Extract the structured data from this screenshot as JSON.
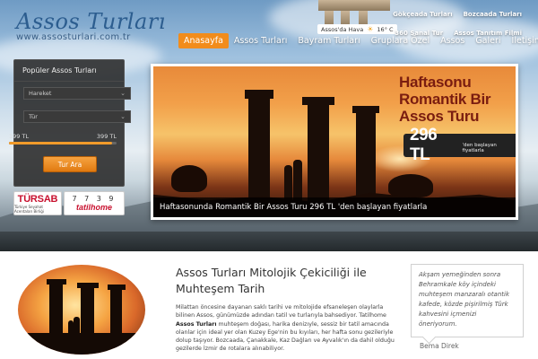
{
  "header": {
    "logo_title": "Assos Turları",
    "logo_url": "www.assosturlari.com.tr",
    "weather_label": "Assos'da Hava",
    "weather_temp": "16° C",
    "top_links_row1": [
      "Gökçeada Turları",
      "Bozcaada Turları"
    ],
    "top_links_row2": [
      "360 Sanal Tur",
      "Assos Tanıtım Filmi"
    ]
  },
  "nav": {
    "items": [
      "Anasayfa",
      "Assos Turları",
      "Bayram Turları",
      "Gruplara Özel",
      "Assos",
      "Galeri",
      "İletişim"
    ],
    "active_index": 0
  },
  "search": {
    "title": "Popüler Assos Turları",
    "departure_placeholder": "Hareket",
    "type_placeholder": "Tür",
    "price_min": "199 TL",
    "price_max": "399 TL",
    "range_fill_fraction": 0.96,
    "button_label": "Tur Ara"
  },
  "badges": {
    "tursab": "TÜRSAB",
    "tursab_sub": "Türkiye Seyahat Acentaları Birliği",
    "tatil_digits": "7 7 3 9",
    "tatil_name": "tatilhome"
  },
  "slider": {
    "headline_lines": [
      "Haftasonu",
      "Romantik Bir",
      "Assos Turu"
    ],
    "price": "296 TL",
    "price_suffix": "'den başlayan fiyatlarla",
    "caption": "Haftasonunda Romantik Bir Assos Turu 296 TL 'den başlayan fiyatlarla"
  },
  "article": {
    "title": "Assos Turları Mitolojik Çekiciliği ile Muhteşem Tarih",
    "body_1": "Milattan öncesine dayanan saklı tarihi ve mitolojide efsaneleşen olaylarla bilinen Assos, günümüzde adından tatil ve turlarıyla bahsediyor. Tatilhome ",
    "body_bold": "Assos Turları",
    "body_2": " muhteşem doğası, harika denizıyle, sessiz bir tatil amacında olanlar için ideal yer olan Kuzey Ege'nin bu kıyıları, her hafta sonu gezileriyle dolup taşıyor. Bozcaada, Çanakkale, Kaz Dağları ve Ayvalık'ın da dahil olduğu gezilerde İzmir de rotalara alınabiliyor."
  },
  "testimonial": {
    "text": "Akşam yemeğinden sonra Behramkale köy içindeki muhteşem manzaralı otantik kafede, közde pişirilmiş Türk kahvesini içmenizi öneriyorum.",
    "author": "Bema Direk"
  },
  "colors": {
    "accent": "#f28c1b",
    "logo_blue": "#2c5d8f",
    "headline_red": "#7a1d10",
    "tursab_red": "#c8102e"
  }
}
